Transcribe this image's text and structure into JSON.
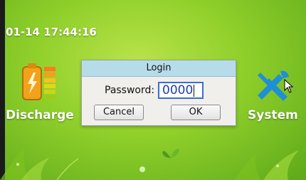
{
  "status": {
    "datetime": "01-14 17:44:16"
  },
  "apps": [
    {
      "label": "Discharge",
      "icon": "battery-icon"
    },
    {
      "label": "System",
      "icon": "tools-icon"
    }
  ],
  "login_dialog": {
    "title": "Login",
    "password_label": "Password:",
    "password_value": "0000",
    "cancel_label": "Cancel",
    "ok_label": "OK"
  },
  "colors": {
    "background": "#8fcf2a",
    "dialog_title_bar": "#b7dce9",
    "input_border": "#3a6fc9",
    "system_icon": "#1f8fd6"
  }
}
